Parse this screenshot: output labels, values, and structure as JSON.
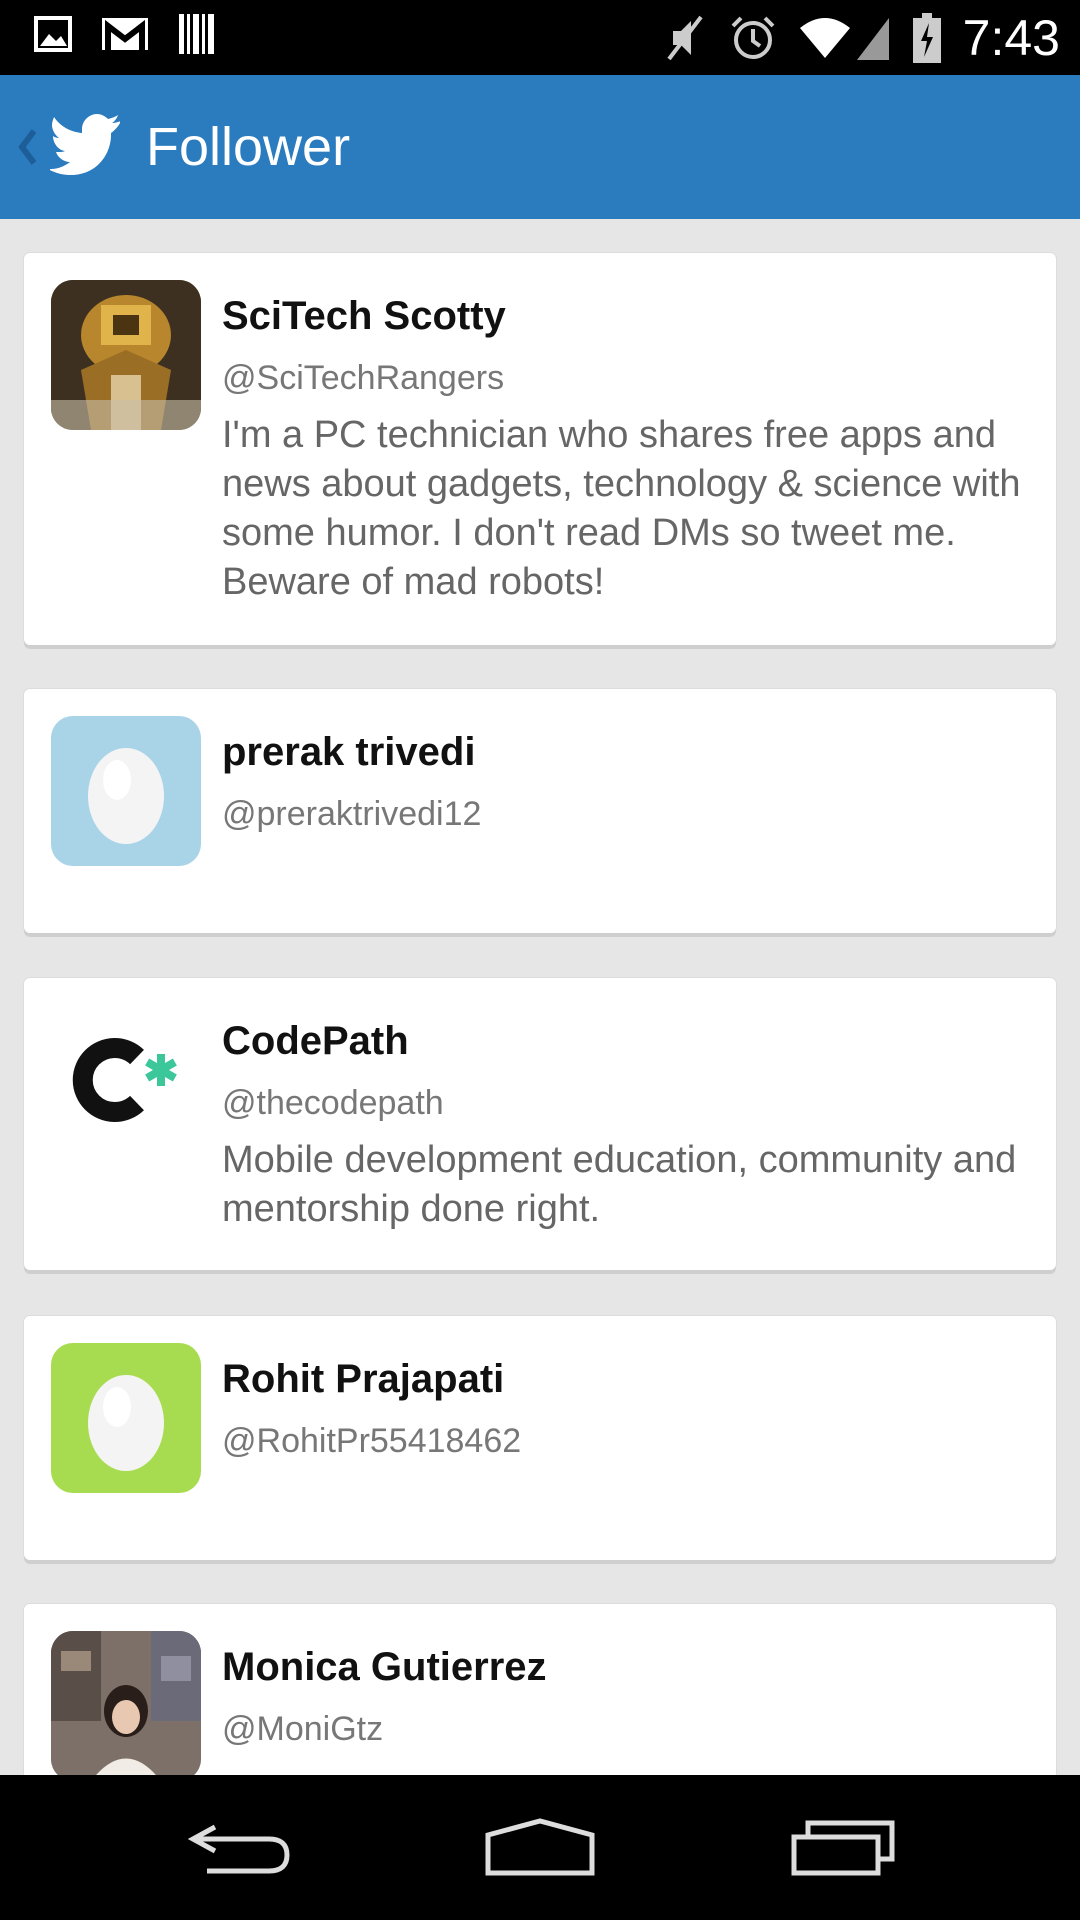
{
  "status_bar": {
    "time": "7:43",
    "left_icons": [
      "image-icon",
      "gmail-icon",
      "barcode-icon"
    ],
    "right_icons": [
      "mute-icon",
      "alarm-icon",
      "wifi-icon",
      "signal-icon",
      "battery-icon"
    ]
  },
  "action_bar": {
    "title": "Follower",
    "back_icon": "chevron-left-icon",
    "logo_icon": "twitter-bird-icon",
    "color": "#2b7bbf"
  },
  "followers": [
    {
      "name": "SciTech Scotty",
      "handle": "@SciTechRangers",
      "bio": "I'm a PC technician who shares free apps and news about gadgets, technology & science with some humor. I don't read DMs so tweet me. Beware of mad robots!",
      "avatar": "robot-photo"
    },
    {
      "name": "prerak trivedi",
      "handle": "@preraktrivedi12",
      "bio": "",
      "avatar": "egg-blue"
    },
    {
      "name": "CodePath",
      "handle": "@thecodepath",
      "bio": "Mobile development education, community and mentorship done right.",
      "avatar": "codepath-logo"
    },
    {
      "name": "Rohit Prajapati",
      "handle": "@RohitPr55418462",
      "bio": "",
      "avatar": "egg-green"
    },
    {
      "name": "Monica Gutierrez",
      "handle": "@MoniGtz",
      "bio": "",
      "avatar": "person-photo"
    }
  ],
  "nav_bar": {
    "buttons": [
      "back-nav-icon",
      "home-nav-icon",
      "recents-nav-icon"
    ]
  }
}
